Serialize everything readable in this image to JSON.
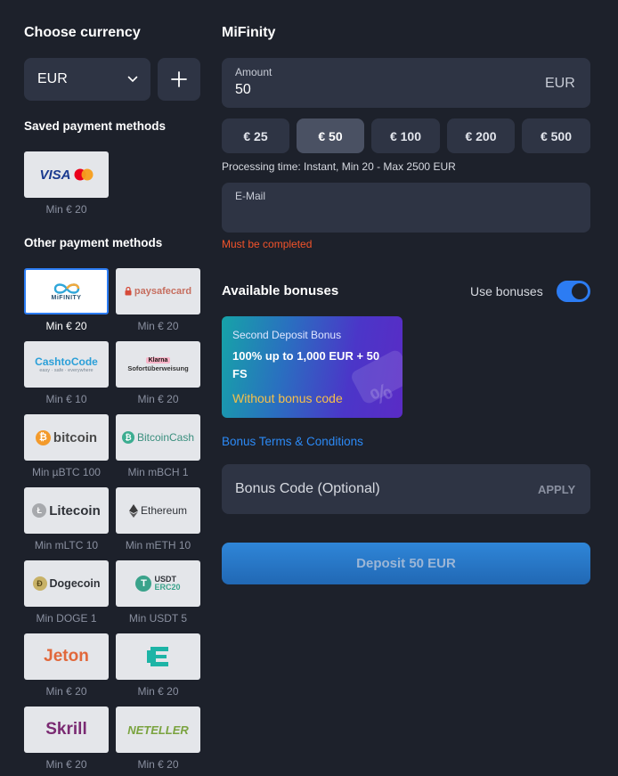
{
  "left": {
    "choose_currency": "Choose currency",
    "currency_value": "EUR",
    "saved_title": "Saved payment methods",
    "saved": [
      {
        "name": "visa-mastercard",
        "visa_text": "VISA",
        "caption": "Min € 20"
      }
    ],
    "other_title": "Other payment methods",
    "methods": [
      {
        "name": "mifinity",
        "logo": "MiFINITY",
        "caption": "Min € 20",
        "selected": true
      },
      {
        "name": "paysafecard",
        "logo": "paysafecard",
        "caption": "Min € 20"
      },
      {
        "name": "cashtocode",
        "logo": "CashtoCode",
        "logo_sub": "easy · safe · everywhere",
        "caption": "Min € 10"
      },
      {
        "name": "sofort",
        "logo_badge": "Klarna",
        "logo": "Sofortüberweisung",
        "caption": "Min € 20"
      },
      {
        "name": "bitcoin",
        "logo": "bitcoin",
        "caption": "Min µBTC 100"
      },
      {
        "name": "bitcoincash",
        "logo": "BitcoinCash",
        "caption": "Min mBCH 1"
      },
      {
        "name": "litecoin",
        "logo": "Litecoin",
        "caption": "Min mLTC 10"
      },
      {
        "name": "ethereum",
        "logo": "Ethereum",
        "caption": "Min mETH 10"
      },
      {
        "name": "dogecoin",
        "logo": "Dogecoin",
        "caption": "Min DOGE 1"
      },
      {
        "name": "usdt-erc20",
        "logo": "USDT",
        "logo_sub": "ERC20",
        "caption": "Min USDT 5"
      },
      {
        "name": "jeton",
        "logo": "Jeton",
        "caption": "Min € 20"
      },
      {
        "name": "ecopayz",
        "logo": "E",
        "caption": "Min € 20"
      },
      {
        "name": "skrill",
        "logo": "Skrill",
        "caption": "Min € 20"
      },
      {
        "name": "neteller",
        "logo": "NETELLER",
        "caption": "Min € 20"
      }
    ]
  },
  "right": {
    "method_title": "MiFinity",
    "amount_label": "Amount",
    "amount_value": "50",
    "amount_currency": "EUR",
    "presets": [
      "€ 25",
      "€ 50",
      "€ 100",
      "€ 200",
      "€ 500"
    ],
    "active_preset": "€ 50",
    "processing": "Processing time: Instant, Min 20 - Max 2500 EUR",
    "email_label": "E-Mail",
    "email_value": "",
    "email_error": "Must be completed",
    "bonuses_title": "Available bonuses",
    "use_bonuses": "Use bonuses",
    "use_bonuses_on": true,
    "bonus": {
      "kicker": "Second Deposit Bonus",
      "headline": "100% up to 1,000 EUR + 50 FS",
      "note": "Without bonus code"
    },
    "terms": "Bonus Terms & Conditions",
    "code_placeholder": "Bonus Code (Optional)",
    "apply": "APPLY",
    "deposit": "Deposit 50 EUR"
  },
  "colors": {
    "background": "#1d212b",
    "panel": "#2e3444",
    "accent": "#2c7cf3",
    "error": "#f2532b",
    "bonus_note": "#f6c04a"
  }
}
